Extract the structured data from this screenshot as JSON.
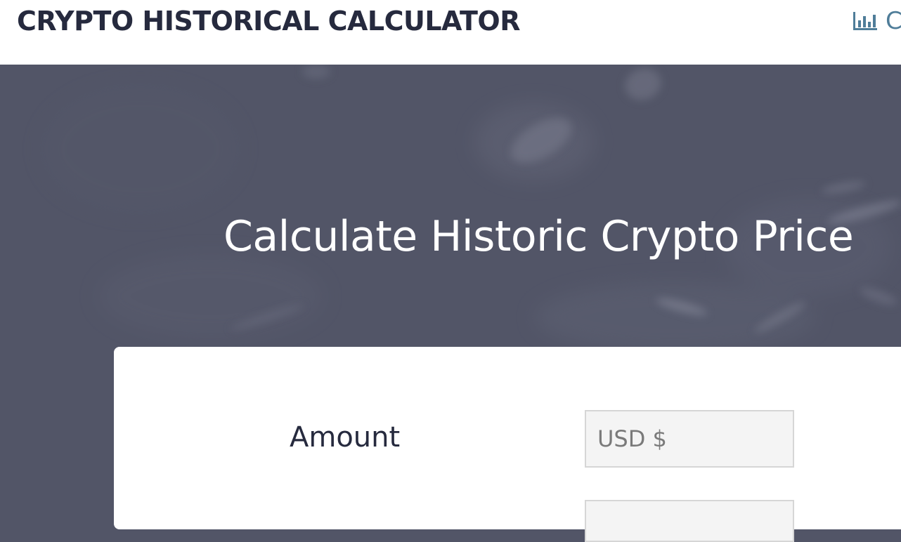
{
  "header": {
    "site_title": "CRYPTO HISTORICAL CALCULATOR",
    "nav_link_text": "C",
    "nav_icon": "bar-chart-icon",
    "accent_color": "#4f7d99"
  },
  "hero": {
    "title": "Calculate Historic Crypto Price",
    "background_color": "#525567"
  },
  "form": {
    "amount_label": "Amount",
    "amount_placeholder": "USD $",
    "amount_value": ""
  }
}
